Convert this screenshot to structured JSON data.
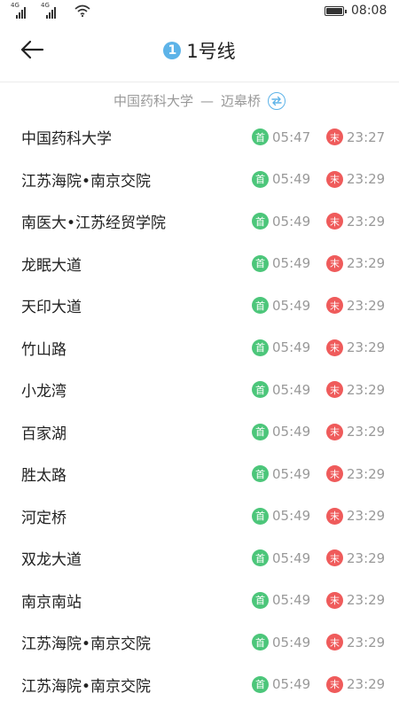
{
  "status_bar": {
    "signal1_label": "4G",
    "signal2_label": "4G",
    "time": "08:08"
  },
  "header": {
    "line_number": "1",
    "title": "1号线"
  },
  "direction": {
    "from": "中国药科大学",
    "separator": "—",
    "to": "迈皋桥"
  },
  "labels": {
    "first": "首",
    "last": "末"
  },
  "colors": {
    "accent": "#5db3e8",
    "first_badge": "#4cc67a",
    "last_badge": "#ef5b5b"
  },
  "stations": [
    {
      "name": "中国药科大学",
      "first": "05:47",
      "last": "23:27"
    },
    {
      "name": "江苏海院•南京交院",
      "first": "05:49",
      "last": "23:29"
    },
    {
      "name": "南医大•江苏经贸学院",
      "first": "05:49",
      "last": "23:29"
    },
    {
      "name": "龙眠大道",
      "first": "05:49",
      "last": "23:29"
    },
    {
      "name": "天印大道",
      "first": "05:49",
      "last": "23:29"
    },
    {
      "name": "竹山路",
      "first": "05:49",
      "last": "23:29"
    },
    {
      "name": "小龙湾",
      "first": "05:49",
      "last": "23:29"
    },
    {
      "name": "百家湖",
      "first": "05:49",
      "last": "23:29"
    },
    {
      "name": "胜太路",
      "first": "05:49",
      "last": "23:29"
    },
    {
      "name": "河定桥",
      "first": "05:49",
      "last": "23:29"
    },
    {
      "name": "双龙大道",
      "first": "05:49",
      "last": "23:29"
    },
    {
      "name": "南京南站",
      "first": "05:49",
      "last": "23:29"
    },
    {
      "name": "江苏海院•南京交院",
      "first": "05:49",
      "last": "23:29"
    },
    {
      "name": "江苏海院•南京交院",
      "first": "05:49",
      "last": "23:29"
    }
  ]
}
